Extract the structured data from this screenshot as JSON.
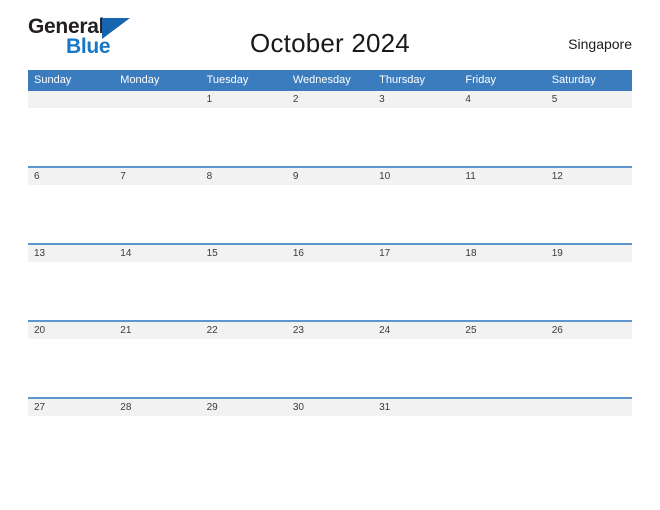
{
  "brand": {
    "name_part1": "General",
    "name_part2": "Blue",
    "triangle_icon": "triangle-icon",
    "color_dark": "#231f20",
    "color_blue": "#1878c6"
  },
  "header": {
    "title": "October 2024",
    "country": "Singapore"
  },
  "theme": {
    "header_blue": "#3a7cbd",
    "row_divider_blue": "#5c98cf",
    "date_band_gray": "#f2f2f2",
    "date_text": "#3b3b3b"
  },
  "calendar": {
    "month": "October",
    "year": "2024",
    "weekday_headers": [
      "Sunday",
      "Monday",
      "Tuesday",
      "Wednesday",
      "Thursday",
      "Friday",
      "Saturday"
    ],
    "weeks": [
      {
        "dates": [
          "",
          "",
          "1",
          "2",
          "3",
          "4",
          "5"
        ]
      },
      {
        "dates": [
          "6",
          "7",
          "8",
          "9",
          "10",
          "11",
          "12"
        ]
      },
      {
        "dates": [
          "13",
          "14",
          "15",
          "16",
          "17",
          "18",
          "19"
        ]
      },
      {
        "dates": [
          "20",
          "21",
          "22",
          "23",
          "24",
          "25",
          "26"
        ]
      },
      {
        "dates": [
          "27",
          "28",
          "29",
          "30",
          "31",
          "",
          ""
        ]
      }
    ]
  }
}
